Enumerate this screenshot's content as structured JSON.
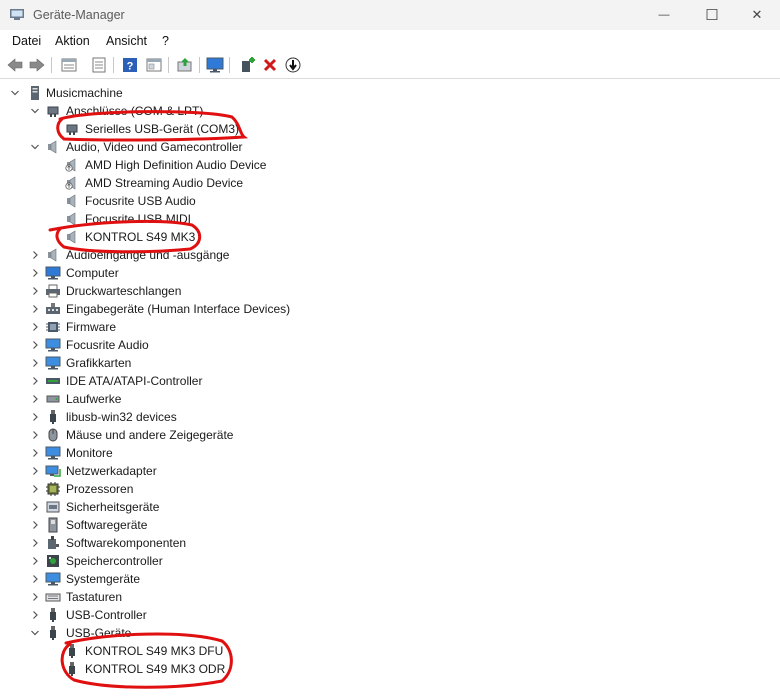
{
  "window": {
    "title": "Geräte-Manager",
    "minimize_glyph": "—",
    "maximize_glyph": "☐",
    "close_glyph": "✕"
  },
  "menu": [
    "Datei",
    "Aktion",
    "Ansicht",
    "?"
  ],
  "toolbar": [
    "back-arrow-icon",
    "forward-arrow-icon",
    "properties-icon",
    "device-list-icon",
    "help-icon",
    "resource-view-icon",
    "update-driver-icon",
    "monitor-icon",
    "add-device-icon",
    "uninstall-x-icon",
    "disable-down-icon"
  ],
  "tree": {
    "root": "Musicmachine",
    "categories": [
      {
        "label": "Anschlüsse (COM & LPT)",
        "icon": "port-icon",
        "expanded": true,
        "children": [
          {
            "label": "Serielles USB-Gerät (COM3)",
            "icon": "port-icon"
          }
        ]
      },
      {
        "label": "Audio, Video und Gamecontroller",
        "icon": "speaker-icon",
        "expanded": true,
        "children": [
          {
            "label": "AMD High Definition Audio Device",
            "icon": "speaker-warning-icon"
          },
          {
            "label": "AMD Streaming Audio Device",
            "icon": "speaker-warning-icon"
          },
          {
            "label": "Focusrite USB Audio",
            "icon": "speaker-icon"
          },
          {
            "label": "Focusrite USB MIDI",
            "icon": "speaker-icon"
          },
          {
            "label": "KONTROL S49 MK3",
            "icon": "speaker-icon"
          }
        ]
      },
      {
        "label": "Audioeingänge und -ausgänge",
        "icon": "speaker-icon",
        "expanded": false
      },
      {
        "label": "Computer",
        "icon": "computer-icon",
        "expanded": false
      },
      {
        "label": "Druckwarteschlangen",
        "icon": "printer-icon",
        "expanded": false
      },
      {
        "label": "Eingabegeräte (Human Interface Devices)",
        "icon": "hid-icon",
        "expanded": false
      },
      {
        "label": "Firmware",
        "icon": "firmware-icon",
        "expanded": false
      },
      {
        "label": "Focusrite Audio",
        "icon": "monitor-icon",
        "expanded": false
      },
      {
        "label": "Grafikkarten",
        "icon": "monitor-icon",
        "expanded": false
      },
      {
        "label": "IDE ATA/ATAPI-Controller",
        "icon": "ide-icon",
        "expanded": false
      },
      {
        "label": "Laufwerke",
        "icon": "drive-icon",
        "expanded": false
      },
      {
        "label": "libusb-win32 devices",
        "icon": "usb-plug-icon",
        "expanded": false
      },
      {
        "label": "Mäuse und andere Zeigegeräte",
        "icon": "mouse-icon",
        "expanded": false
      },
      {
        "label": "Monitore",
        "icon": "monitor-icon",
        "expanded": false
      },
      {
        "label": "Netzwerkadapter",
        "icon": "network-icon",
        "expanded": false
      },
      {
        "label": "Prozessoren",
        "icon": "cpu-icon",
        "expanded": false
      },
      {
        "label": "Sicherheitsgeräte",
        "icon": "security-icon",
        "expanded": false
      },
      {
        "label": "Softwaregeräte",
        "icon": "software-device-icon",
        "expanded": false
      },
      {
        "label": "Softwarekomponenten",
        "icon": "software-component-icon",
        "expanded": false
      },
      {
        "label": "Speichercontroller",
        "icon": "storage-controller-icon",
        "expanded": false
      },
      {
        "label": "Systemgeräte",
        "icon": "monitor-icon",
        "expanded": false
      },
      {
        "label": "Tastaturen",
        "icon": "keyboard-icon",
        "expanded": false
      },
      {
        "label": "USB-Controller",
        "icon": "usb-plug-icon",
        "expanded": false
      },
      {
        "label": "USB-Geräte",
        "icon": "usb-plug-icon",
        "expanded": true,
        "children": [
          {
            "label": "KONTROL S49 MK3 DFU",
            "icon": "usb-plug-icon"
          },
          {
            "label": "KONTROL S49 MK3 ODR",
            "icon": "usb-plug-icon"
          }
        ]
      }
    ]
  },
  "colors": {
    "annotation_red": "#e01010",
    "chevron": "#555555",
    "accent_blue": "#1e6fd1"
  }
}
